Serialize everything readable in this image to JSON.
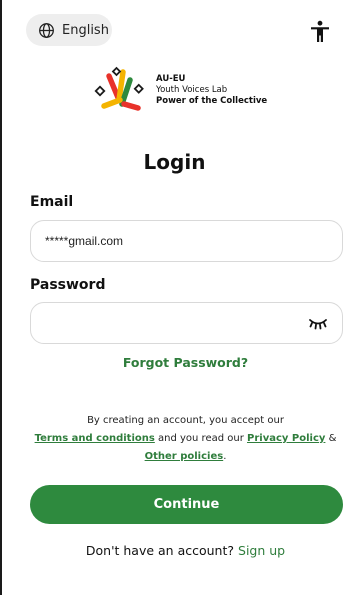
{
  "header": {
    "language_label": "English",
    "language_icon": "globe-icon",
    "accessibility_icon": "accessibility-icon"
  },
  "brand": {
    "line1": "AU-EU",
    "line2": "Youth Voices Lab",
    "line3": "Power of the Collective",
    "logo_colors": [
      "#e8322a",
      "#f4b400",
      "#2e8a3e",
      "#1b1b1b"
    ]
  },
  "form": {
    "title": "Login",
    "email_label": "Email",
    "email_value": "*****gmail.com",
    "password_label": "Password",
    "password_value": "",
    "password_toggle_icon": "eye-closed-icon",
    "forgot_label": "Forgot Password?"
  },
  "terms": {
    "prefix": "By creating an account, you accept our",
    "terms_link": "Terms and conditions",
    "middle": "and you read our",
    "privacy_link": "Privacy Policy",
    "amp": "&",
    "other_link": "Other policies",
    "suffix": "."
  },
  "actions": {
    "continue_label": "Continue",
    "no_account_text": "Don't have an account?",
    "signup_label": "Sign up"
  },
  "colors": {
    "accent": "#2e8a3e",
    "link": "#2f7d3c"
  }
}
